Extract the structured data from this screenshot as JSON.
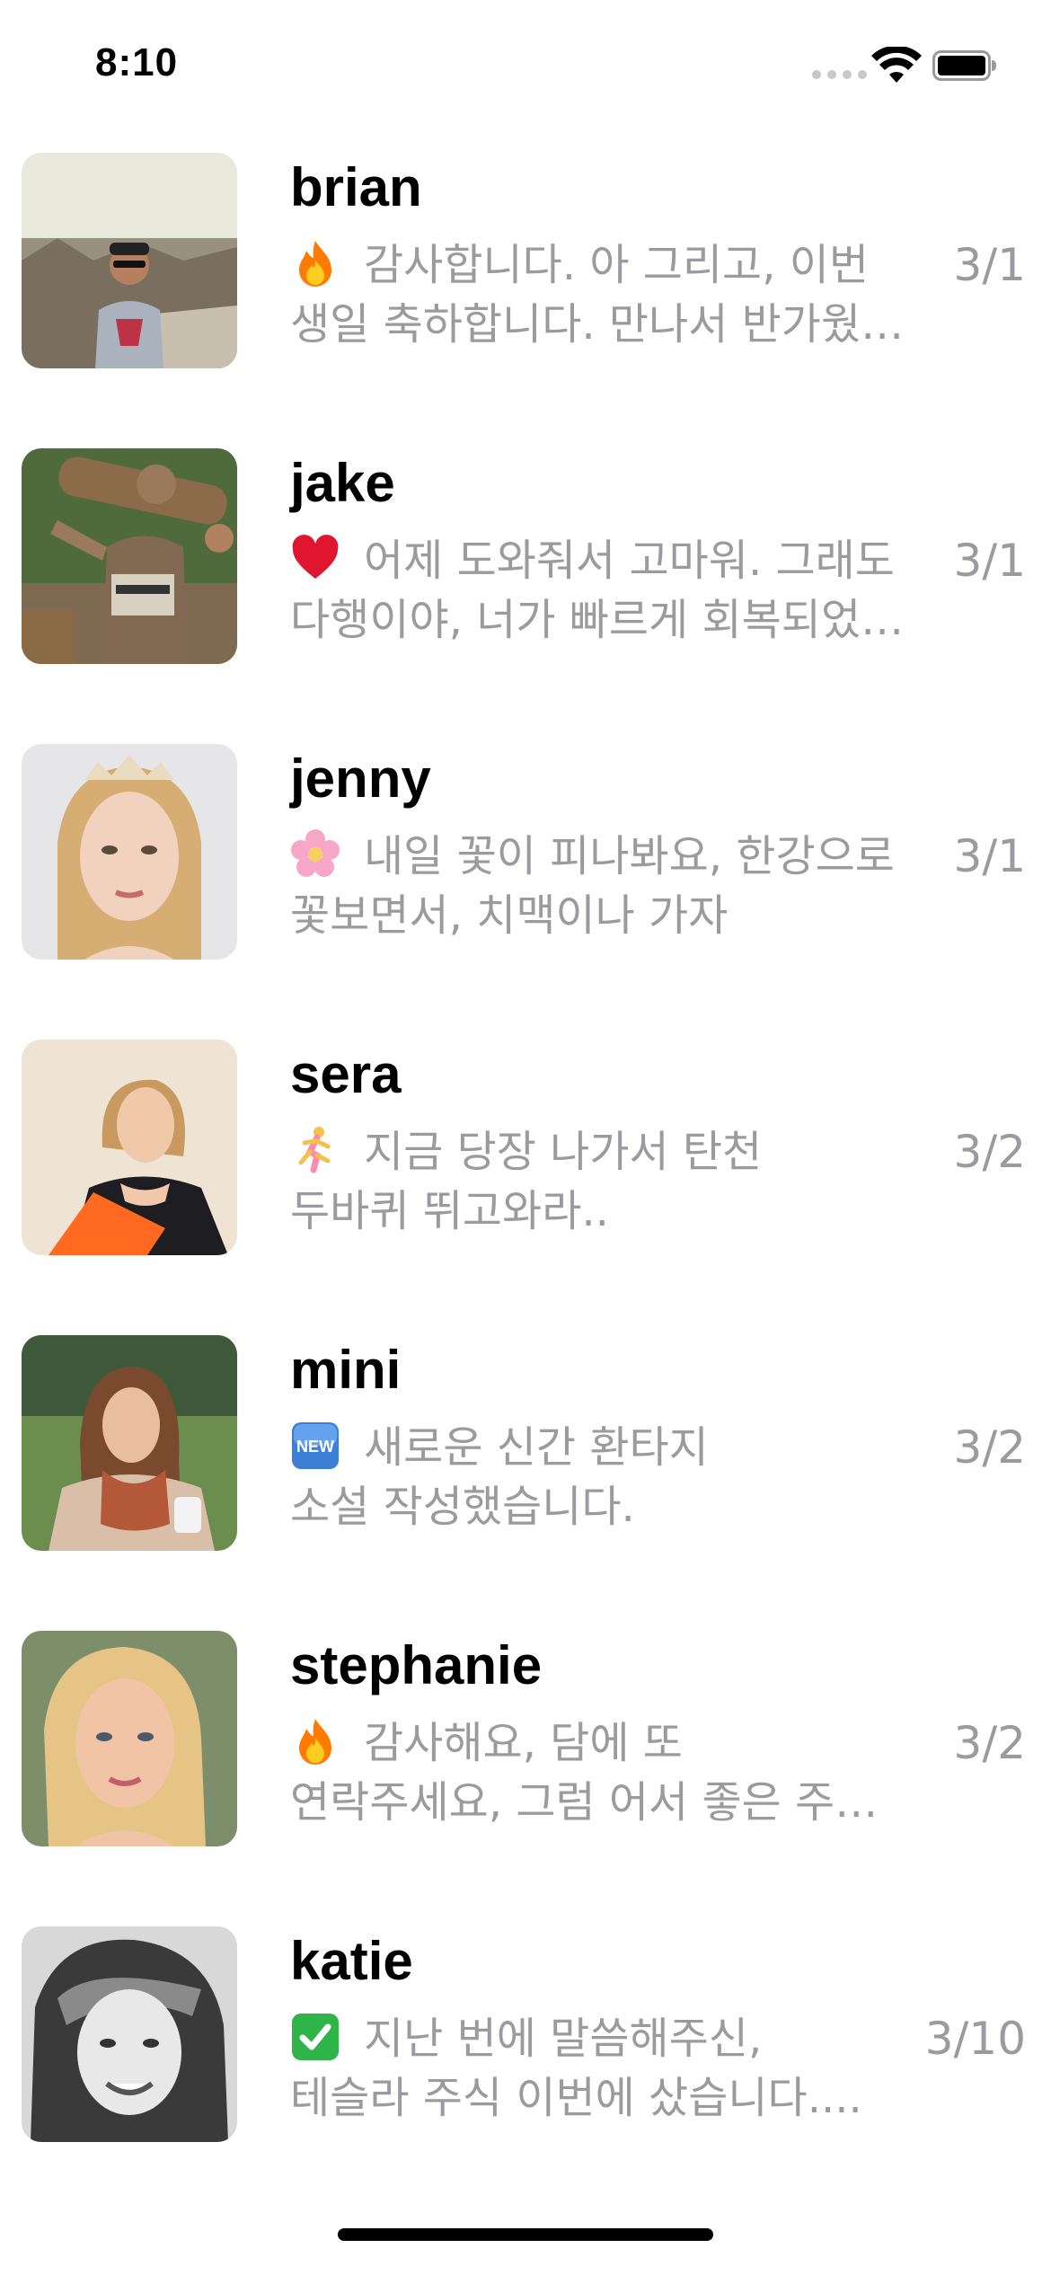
{
  "status_bar": {
    "time": "8:10"
  },
  "chats": [
    {
      "name": "brian",
      "emoji": "fire-icon",
      "message_line1": "감사합니다. 아 그리고, 이번",
      "message_line2": "생일 축하합니다. 만나서 반가웠…",
      "date": "3/1"
    },
    {
      "name": "jake",
      "emoji": "heart-icon",
      "message_line1": "어제 도와줘서 고마워. 그래도",
      "message_line2": "다행이야, 너가 빠르게 회복되었…",
      "date": "3/1"
    },
    {
      "name": "jenny",
      "emoji": "cherry-blossom-icon",
      "message_line1": "내일 꽃이 피나봐요, 한강으로",
      "message_line2": "꽃보면서, 치맥이나 가자",
      "date": "3/1"
    },
    {
      "name": "sera",
      "emoji": "runner-icon",
      "message_line1": "지금 당장 나가서 탄천",
      "message_line2": "두바퀴 뛰고와라..",
      "date": "3/2"
    },
    {
      "name": "mini",
      "emoji": "new-badge-icon",
      "message_line1": "새로운 신간 환타지",
      "message_line2": "소설 작성했습니다.",
      "date": "3/2"
    },
    {
      "name": "stephanie",
      "emoji": "fire-icon",
      "message_line1": "감사해요, 담에 또",
      "message_line2": "연락주세요, 그럼 어서 좋은 주…",
      "date": "3/2"
    },
    {
      "name": "katie",
      "emoji": "check-mark-icon",
      "message_line1": "지난 번에 말씀해주신,",
      "message_line2": "테슬라 주식 이번에 샀습니다....",
      "date": "3/10"
    }
  ]
}
